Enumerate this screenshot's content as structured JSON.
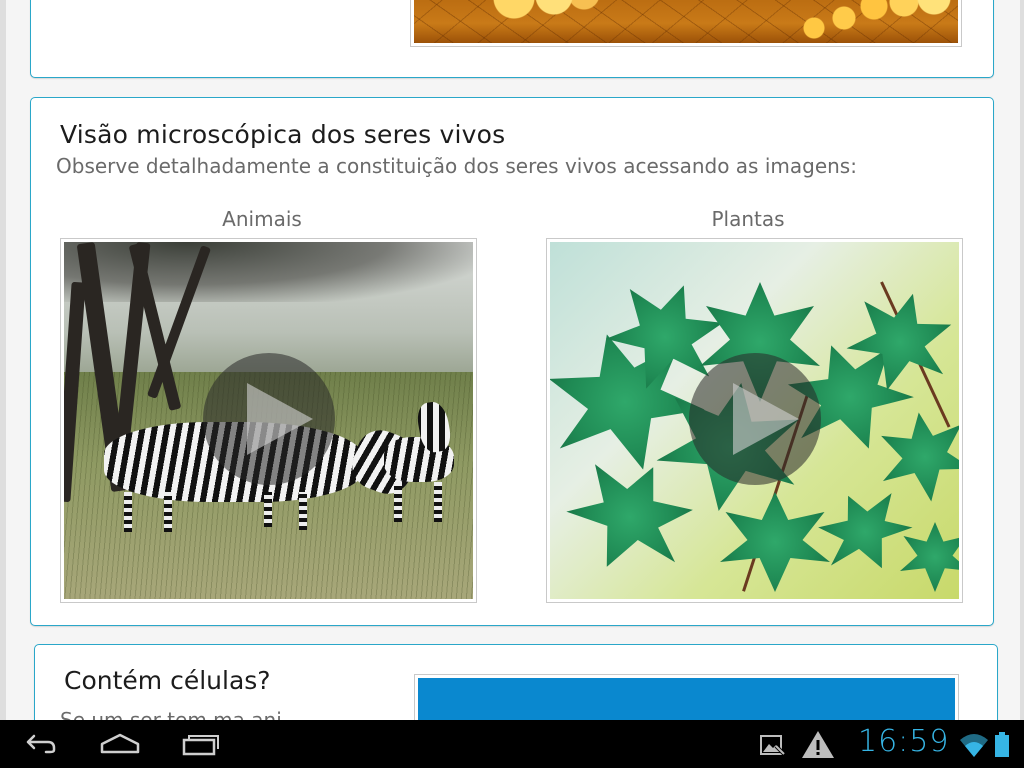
{
  "section": {
    "title": "Visão microscópica dos seres vivos",
    "subtitle": "Observe detalhadamente a constituição dos seres vivos acessando as imagens:"
  },
  "thumbnails": [
    {
      "caption": "Animais",
      "icon": "play-icon"
    },
    {
      "caption": "Plantas",
      "icon": "play-icon"
    }
  ],
  "next_section": {
    "title": "Contém células?",
    "subtitle": "Se um ser tem ma   ani"
  },
  "status_bar": {
    "time": "16:59",
    "icons": [
      "gallery-notification-icon",
      "warning-icon",
      "wifi-icon",
      "battery-icon"
    ]
  },
  "nav_bar": {
    "icons": [
      "back-icon",
      "home-icon",
      "recent-apps-icon"
    ]
  },
  "colors": {
    "accent": "#2aa7c9",
    "clock": "#36b5e5"
  }
}
